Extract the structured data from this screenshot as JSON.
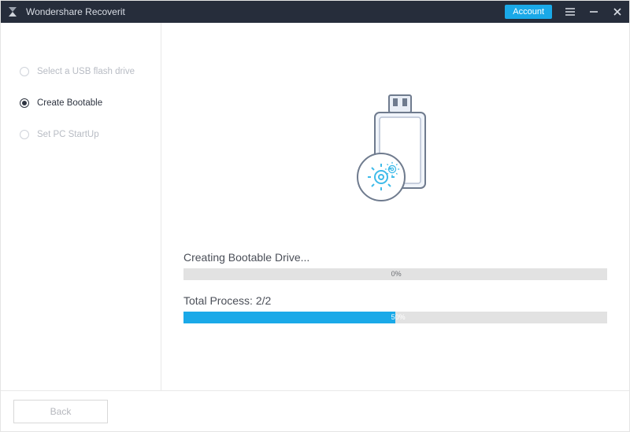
{
  "app": {
    "title": "Wondershare Recoverit",
    "account_label": "Account"
  },
  "sidebar": {
    "steps": [
      {
        "label": "Select a USB flash drive",
        "active": false
      },
      {
        "label": "Create Bootable",
        "active": true
      },
      {
        "label": "Set PC StartUp",
        "active": false
      }
    ]
  },
  "progress": {
    "creating_label": "Creating Bootable Drive...",
    "creating_percent": 0,
    "creating_percent_text": "0%",
    "total_label": "Total Process: 2/2",
    "total_percent": 50,
    "total_percent_text": "50%"
  },
  "footer": {
    "back_label": "Back"
  },
  "colors": {
    "accent": "#1aa9e8",
    "titlebar_bg": "#262d3b",
    "progress_bg": "#e2e2e2"
  }
}
